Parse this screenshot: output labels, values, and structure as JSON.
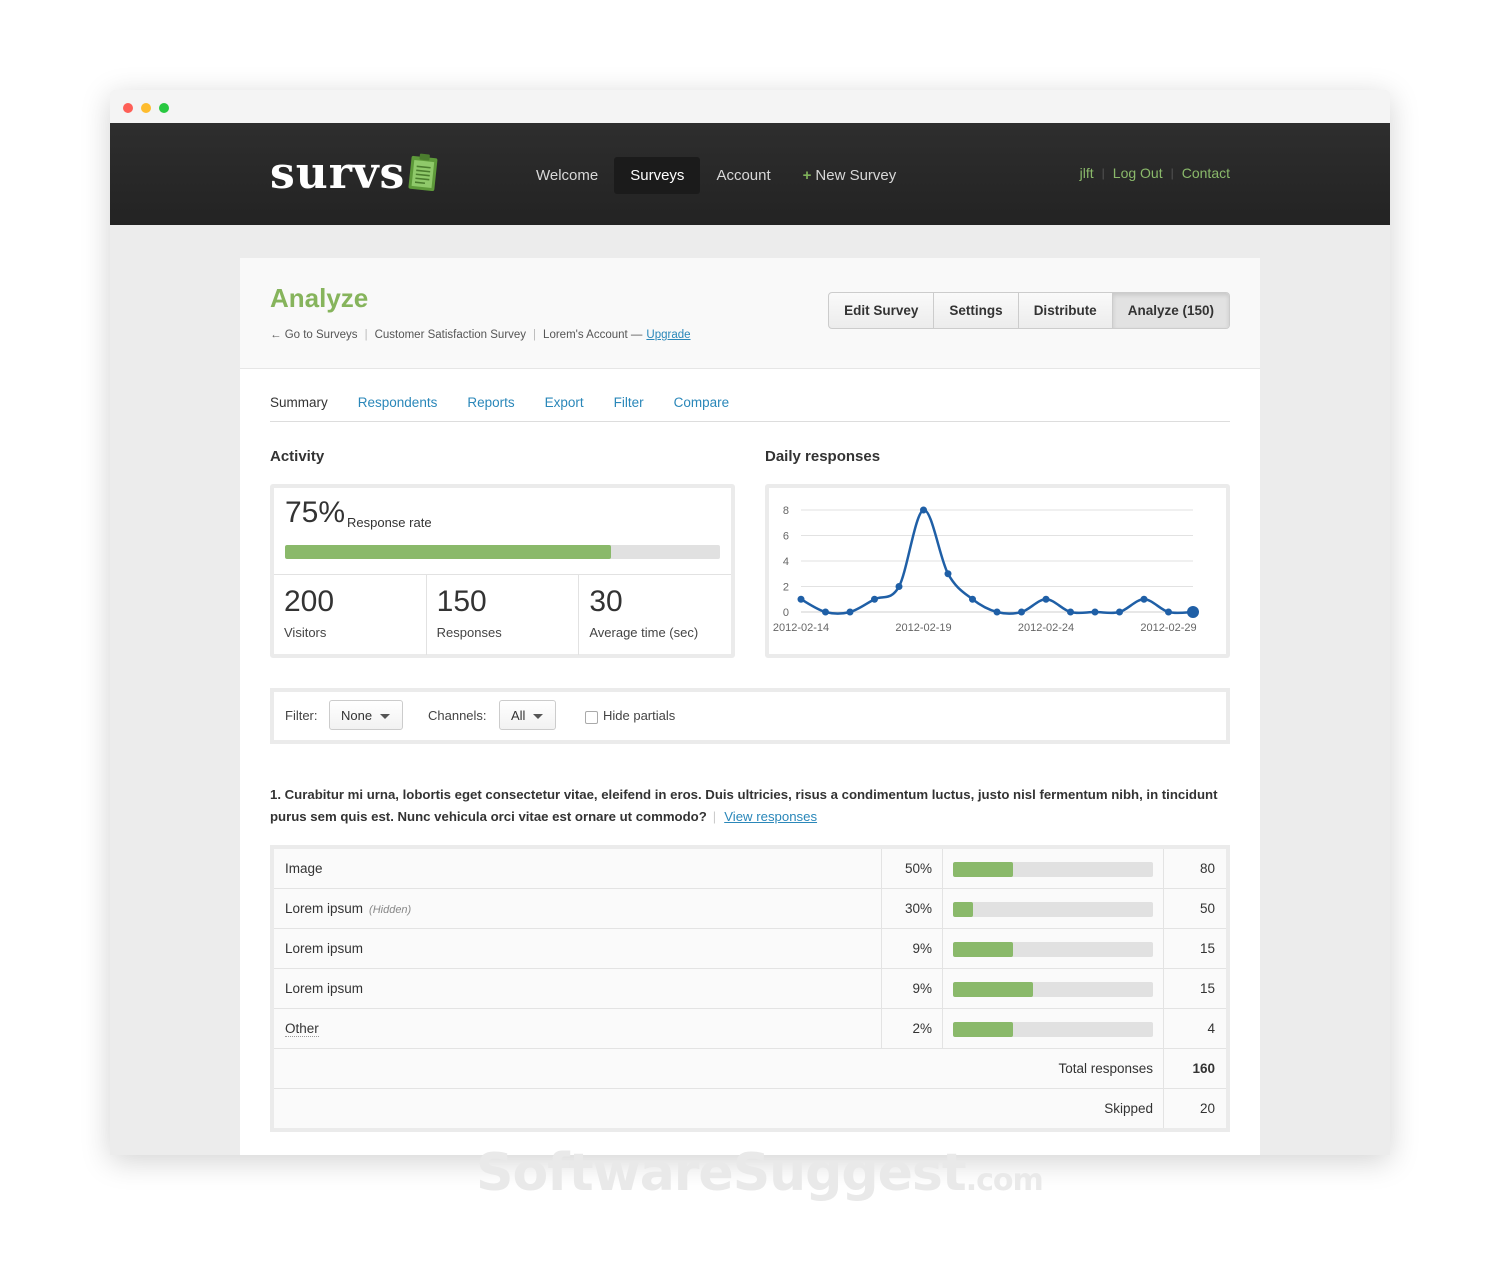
{
  "app": {
    "logo_text": "survs",
    "nav": [
      "Welcome",
      "Surveys",
      "Account",
      "New Survey"
    ],
    "user_links": [
      "jlft",
      "Log Out",
      "Contact"
    ]
  },
  "header": {
    "title": "Analyze",
    "breadcrumbs": [
      "← Go to Surveys",
      "Customer Satisfaction Survey",
      "Lorem's Account —"
    ],
    "upgrade_link": "Upgrade",
    "buttons": [
      "Edit Survey",
      "Settings",
      "Distribute",
      "Analyze (150)"
    ]
  },
  "subtabs": [
    "Summary",
    "Respondents",
    "Reports",
    "Export",
    "Filter",
    "Compare"
  ],
  "activity": {
    "heading": "Activity",
    "response_rate": "75%",
    "response_rate_label": "Response rate",
    "response_rate_fraction": 0.75,
    "stats": [
      {
        "value": "200",
        "label": "Visitors"
      },
      {
        "value": "150",
        "label": "Responses"
      },
      {
        "value": "30",
        "label": "Average time (sec)"
      }
    ]
  },
  "daily": {
    "heading": "Daily responses"
  },
  "chart_data": {
    "type": "line",
    "x": [
      "2012-02-14",
      "2012-02-15",
      "2012-02-16",
      "2012-02-17",
      "2012-02-18",
      "2012-02-19",
      "2012-02-20",
      "2012-02-21",
      "2012-02-22",
      "2012-02-23",
      "2012-02-24",
      "2012-02-25",
      "2012-02-26",
      "2012-02-27",
      "2012-02-28",
      "2012-02-29",
      "2012-03-01"
    ],
    "series": [
      {
        "values": [
          1,
          0,
          0,
          1,
          2,
          8,
          3,
          1,
          0,
          0,
          1,
          0,
          0,
          0,
          1,
          0,
          0
        ]
      }
    ],
    "x_ticks": [
      "2012-02-14",
      "2012-02-19",
      "2012-02-24",
      "2012-02-29"
    ],
    "y_ticks": [
      0,
      2,
      4,
      6,
      8
    ],
    "ylim": [
      0,
      8
    ],
    "grid": true,
    "line_color": "#1f5fa6"
  },
  "filters": {
    "filter_label": "Filter:",
    "filter_value": "None",
    "channels_label": "Channels:",
    "channels_value": "All",
    "hide_partials_label": "Hide partials"
  },
  "question": {
    "text": "1. Curabitur mi urna, lobortis eget consectetur vitae, eleifend in eros. Duis ultricies, risus a condimentum luctus, justo nisl fermentum nibh, in tincidunt purus sem quis est. Nunc vehicula orci vitae est ornare ut commodo?",
    "view_link": "View responses",
    "answers": [
      {
        "label": "Image",
        "note": "",
        "pct": "50%",
        "bar_fraction": 0.3,
        "count": "80"
      },
      {
        "label": "Lorem ipsum",
        "note": "(Hidden)",
        "pct": "30%",
        "bar_fraction": 0.1,
        "count": "50"
      },
      {
        "label": "Lorem ipsum",
        "note": "",
        "pct": "9%",
        "bar_fraction": 0.3,
        "count": "15"
      },
      {
        "label": "Lorem ipsum",
        "note": "",
        "pct": "9%",
        "bar_fraction": 0.4,
        "count": "15"
      },
      {
        "label": "Other",
        "note": "",
        "pct": "2%",
        "bar_fraction": 0.3,
        "count": "4"
      }
    ],
    "total_label": "Total responses",
    "total_value": "160",
    "skipped_label": "Skipped",
    "skipped_value": "20"
  },
  "colors": {
    "accent_green": "#8ab96a",
    "link_blue": "#2a87b9"
  },
  "watermark": {
    "main": "SoftwareSuggest",
    "suffix": ".com"
  }
}
